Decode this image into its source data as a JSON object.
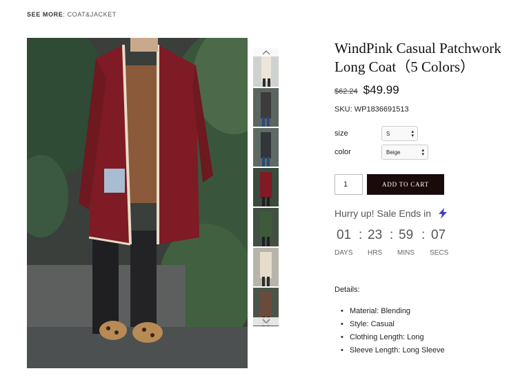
{
  "breadcrumb": {
    "label": "SEE MORE",
    "separator": ": ",
    "link": "COAT&JACKET"
  },
  "product": {
    "title": "WindPink Casual Patchwork Long Coat（5 Colors）",
    "old_price": "$62.24",
    "price": "$49.99",
    "sku": "SKU: WP1836691513"
  },
  "options": {
    "size": {
      "label": "size",
      "value": "S"
    },
    "color": {
      "label": "color",
      "value": "Beige"
    }
  },
  "cart": {
    "quantity": "1",
    "button_label": "ADD TO CART"
  },
  "sale": {
    "text": "Hurry up! Sale Ends in",
    "icon": "lightning-bolt-icon",
    "countdown": [
      {
        "value": "01",
        "label": "DAYS"
      },
      {
        "value": "23",
        "label": "HRS"
      },
      {
        "value": "59",
        "label": "MINS"
      },
      {
        "value": "07",
        "label": "SECS"
      }
    ],
    "separator": ":"
  },
  "details": {
    "title": "Details:",
    "items": [
      "Material: Blending",
      "Style: Casual",
      "Clothing Length: Long",
      "Sleeve Length: Long Sleeve"
    ]
  },
  "colors": {
    "cart_button": "#1b0a0a",
    "coat": "#7e1b24",
    "accent_bolt": "#3d3fc9"
  }
}
